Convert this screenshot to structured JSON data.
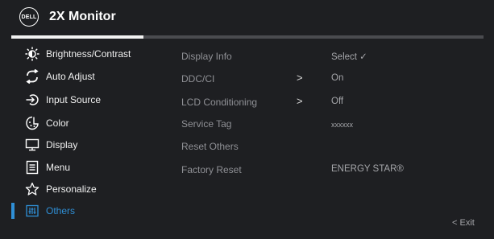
{
  "header": {
    "logo_text": "DELL",
    "title": "2X Monitor"
  },
  "progress": {
    "fraction": 0.28
  },
  "menu": [
    {
      "label": "Brightness/Contrast",
      "icon": "brightness-icon"
    },
    {
      "label": "Auto Adjust",
      "icon": "auto-adjust-icon"
    },
    {
      "label": "Input Source",
      "icon": "input-source-icon"
    },
    {
      "label": "Color",
      "icon": "color-icon"
    },
    {
      "label": "Display",
      "icon": "display-icon"
    },
    {
      "label": "Menu",
      "icon": "menu-icon"
    },
    {
      "label": "Personalize",
      "icon": "star-icon"
    },
    {
      "label": "Others",
      "icon": "others-icon",
      "selected": true
    }
  ],
  "options": [
    {
      "label": "Display Info",
      "value": "Select ✓"
    },
    {
      "label": "DDC/CI",
      "arrow": ">",
      "value": "On"
    },
    {
      "label": "LCD Conditioning",
      "arrow": ">",
      "value": "Off"
    },
    {
      "label": "Service Tag",
      "value": "xxxxxx"
    },
    {
      "label": "Reset Others"
    },
    {
      "label": "Factory Reset",
      "value": "ENERGY STAR®"
    }
  ],
  "footer": {
    "exit_label": "< Exit"
  },
  "colors": {
    "accent": "#2f8fd6",
    "background": "#1e1f22",
    "dim_text": "#8f9095"
  }
}
